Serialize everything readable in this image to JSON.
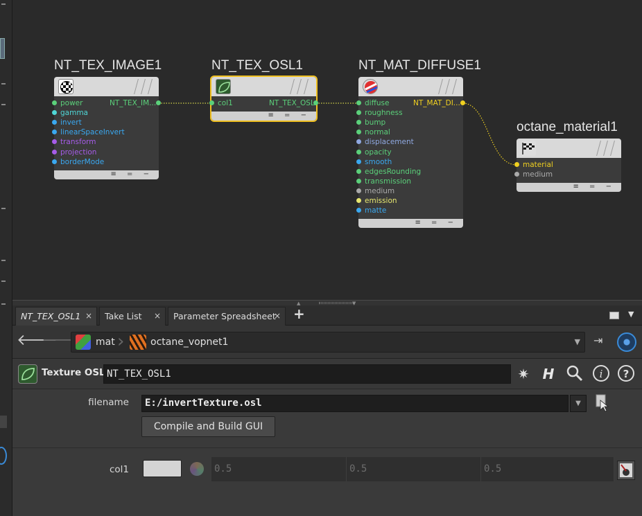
{
  "network": {
    "nodes": [
      {
        "id": "n1",
        "title": "NT_TEX_IMAGE1",
        "output_label": "NT_TEX_IM...",
        "ports": [
          {
            "label": "power",
            "color": "#5bd07a"
          },
          {
            "label": "gamma",
            "color": "#4fd6d6"
          },
          {
            "label": "invert",
            "color": "#3aa8f0"
          },
          {
            "label": "linearSpaceInvert",
            "color": "#3aa8f0"
          },
          {
            "label": "transform",
            "color": "#a65ce8"
          },
          {
            "label": "projection",
            "color": "#a65ce8"
          },
          {
            "label": "borderMode",
            "color": "#3aa8f0"
          }
        ]
      },
      {
        "id": "n2",
        "title": "NT_TEX_OSL1",
        "output_label": "NT_TEX_OSL",
        "ports": [
          {
            "label": "col1",
            "color": "#5bd07a"
          }
        ]
      },
      {
        "id": "n3",
        "title": "NT_MAT_DIFFUSE1",
        "output_label": "NT_MAT_DI...",
        "ports": [
          {
            "label": "diffuse",
            "color": "#5bd07a"
          },
          {
            "label": "roughness",
            "color": "#5bd07a"
          },
          {
            "label": "bump",
            "color": "#5bd07a"
          },
          {
            "label": "normal",
            "color": "#5bd07a"
          },
          {
            "label": "displacement",
            "color": "#8fa8e0"
          },
          {
            "label": "opacity",
            "color": "#5bd07a"
          },
          {
            "label": "smooth",
            "color": "#3aa8f0"
          },
          {
            "label": "edgesRounding",
            "color": "#5bd07a"
          },
          {
            "label": "transmission",
            "color": "#5bd07a"
          },
          {
            "label": "medium",
            "color": "#aaaaaa"
          },
          {
            "label": "emission",
            "color": "#e8e870"
          },
          {
            "label": "matte",
            "color": "#3aa8f0"
          }
        ]
      },
      {
        "id": "n4",
        "title": "octane_material1",
        "ports": [
          {
            "label": "material",
            "color": "#f0d020"
          },
          {
            "label": "medium",
            "color": "#aaaaaa"
          }
        ]
      }
    ],
    "footer_glyphs": "≡ = −"
  },
  "tabs": [
    {
      "label": "NT_TEX_OSL1",
      "active": true
    },
    {
      "label": "Take List",
      "active": false
    },
    {
      "label": "Parameter Spreadsheet",
      "active": false
    }
  ],
  "tab_close": "×",
  "tab_add": "+",
  "path": {
    "root": "mat",
    "network": "octane_vopnet1"
  },
  "param_header": {
    "type_label": "Texture OSL",
    "node_name": "NT_TEX_OSL1"
  },
  "params": {
    "filename_label": "filename",
    "filename_value": "E:/invertTexture.osl",
    "compile_label": "Compile and Build GUI",
    "col1_label": "col1",
    "col1_values": [
      "0.5",
      "0.5",
      "0.5"
    ]
  },
  "colors": {
    "selection": "#f0c020",
    "wire": "#d8d84a",
    "accent_blue": "#3a8bd8"
  }
}
